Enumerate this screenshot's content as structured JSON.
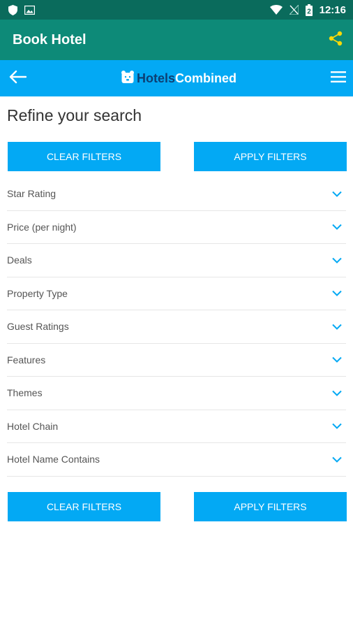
{
  "status_bar": {
    "time": "12:16"
  },
  "app_bar": {
    "title": "Book Hotel"
  },
  "brand_bar": {
    "brand_hotels": "Hotels",
    "brand_combined": "Combined"
  },
  "page": {
    "title": "Refine your search"
  },
  "buttons": {
    "clear": "CLEAR FILTERS",
    "apply": "APPLY FILTERS"
  },
  "filters": [
    "Star Rating",
    "Price (per night)",
    "Deals",
    "Property Type",
    "Guest Ratings",
    "Features",
    "Themes",
    "Hotel Chain",
    "Hotel Name Contains"
  ],
  "colors": {
    "status_bar": "#0a6b5c",
    "app_bar": "#0d8a78",
    "brand_bar": "#03a9f4",
    "button": "#03a9f4",
    "share_icon": "#f5d90a"
  }
}
